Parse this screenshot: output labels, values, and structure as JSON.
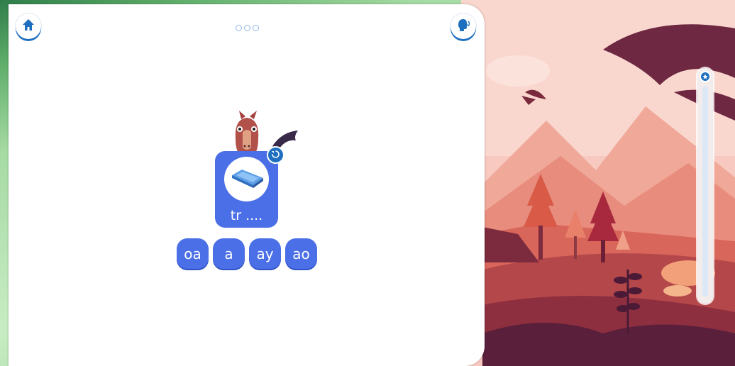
{
  "header": {
    "home_icon": "home-icon",
    "speaker_icon": "speaking-head-icon",
    "page_dots": 3
  },
  "question": {
    "picture": "tray-icon",
    "word": "tr ....",
    "replay_icon": "replay-icon"
  },
  "options": [
    "oa",
    "a",
    "ay",
    "ao"
  ],
  "progress": {
    "level": 0,
    "badge_icon": "star-icon"
  },
  "colors": {
    "accent": "#4b6fe6",
    "accent_dark": "#1f6fc0",
    "panel": "#ffffff"
  }
}
